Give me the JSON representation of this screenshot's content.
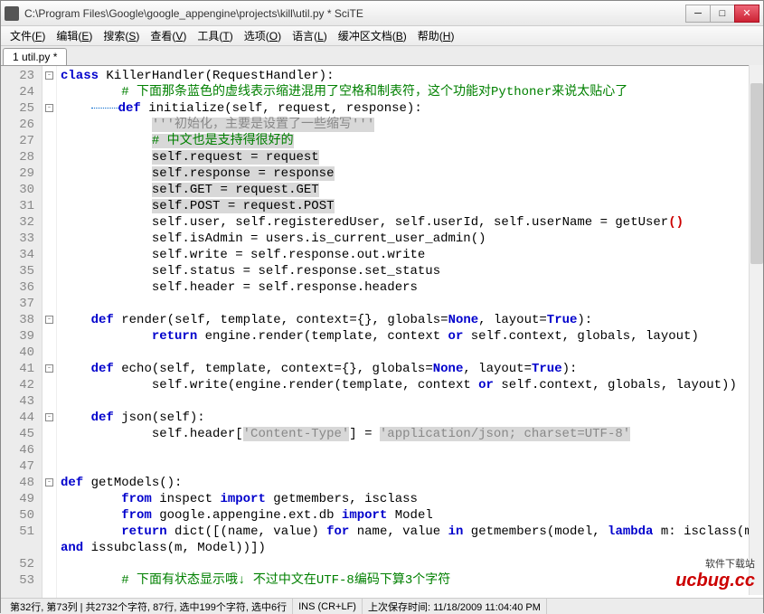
{
  "window": {
    "title": "C:\\Program Files\\Google\\google_appengine\\projects\\kill\\util.py * SciTE"
  },
  "menu": [
    {
      "label": "文件",
      "accel": "F"
    },
    {
      "label": "编辑",
      "accel": "E"
    },
    {
      "label": "搜索",
      "accel": "S"
    },
    {
      "label": "查看",
      "accel": "V"
    },
    {
      "label": "工具",
      "accel": "T"
    },
    {
      "label": "选项",
      "accel": "O"
    },
    {
      "label": "语言",
      "accel": "L"
    },
    {
      "label": "缓冲区文档",
      "accel": "B"
    },
    {
      "label": "帮助",
      "accel": "H"
    }
  ],
  "tabs": [
    {
      "label": "1 util.py *"
    }
  ],
  "gutter_start": 23,
  "gutter_end": 53,
  "statusbar": {
    "pos": "第32行, 第73列 | 共2732个字符, 87行, 选中199个字符, 选中6行",
    "mode": "INS (CR+LF)",
    "saved": "上次保存时间: 11/18/2009 11:04:40 PM"
  },
  "watermark": {
    "brand": "ucbug.cc",
    "sub": "软件下载站"
  },
  "fold_markers": {
    "23": "-",
    "25": "-",
    "38": "-",
    "41": "-",
    "44": "-",
    "48": "-"
  },
  "code": [
    {
      "n": 23,
      "html": "<span class='kw'>class</span> <span class='cls'>KillerHandler</span><span class='op'>(</span>RequestHandler<span class='op'>):</span>"
    },
    {
      "n": 24,
      "html": "    <span class='com'># 下面那条蓝色的虚线表示缩进混用了空格和制表符，这个功能对Pythoner来说太贴心了</span>"
    },
    {
      "n": 25,
      "html": "<span class='blue-line'></span><span class='kw'>def</span> <span class='fn'>initialize</span><span class='op'>(</span>self<span class='op'>,</span> request<span class='op'>,</span> response<span class='op'>):</span>"
    },
    {
      "n": 26,
      "html": "    <span class='sel'><span class='str'>'''初始化，主要是设置了一些缩写'''</span></span>"
    },
    {
      "n": 27,
      "html": "    <span class='sel'><span class='com'># 中文也是支持得很好的</span></span>"
    },
    {
      "n": 28,
      "html": "    <span class='sel'>self<span class='op'>.</span>request <span class='op'>=</span> request</span>"
    },
    {
      "n": 29,
      "html": "    <span class='sel'>self<span class='op'>.</span>response <span class='op'>=</span> response</span>"
    },
    {
      "n": 30,
      "html": "    <span class='sel'>self<span class='op'>.</span>GET <span class='op'>=</span> request<span class='op'>.</span>GET</span>"
    },
    {
      "n": 31,
      "html": "    <span class='sel'>self<span class='op'>.</span>POST <span class='op'>=</span> request<span class='op'>.</span>POST</span>"
    },
    {
      "n": 32,
      "html": "    self<span class='op'>.</span>user<span class='op'>,</span> self<span class='op'>.</span>registeredUser<span class='op'>,</span> self<span class='op'>.</span>userId<span class='op'>,</span> self<span class='op'>.</span>userName <span class='op'>=</span> getUser<span class='paren-red'>()</span>"
    },
    {
      "n": 33,
      "html": "    self<span class='op'>.</span>isAdmin <span class='op'>=</span> users<span class='op'>.</span>is_current_user_admin<span class='op'>()</span>"
    },
    {
      "n": 34,
      "html": "    self<span class='op'>.</span>write <span class='op'>=</span> self<span class='op'>.</span>response<span class='op'>.</span>out<span class='op'>.</span>write"
    },
    {
      "n": 35,
      "html": "    self<span class='op'>.</span>status <span class='op'>=</span> self<span class='op'>.</span>response<span class='op'>.</span>set_status"
    },
    {
      "n": 36,
      "html": "    self<span class='op'>.</span>header <span class='op'>=</span> self<span class='op'>.</span>response<span class='op'>.</span>headers"
    },
    {
      "n": 37,
      "html": ""
    },
    {
      "n": 38,
      "html": "<span class='kw'>def</span> <span class='fn'>render</span><span class='op'>(</span>self<span class='op'>,</span> template<span class='op'>,</span> context<span class='op'>={},</span> globals<span class='op'>=</span><span class='none'>None</span><span class='op'>,</span> layout<span class='op'>=</span><span class='none'>True</span><span class='op'>):</span>"
    },
    {
      "n": 39,
      "html": "    <span class='kw'>return</span> engine<span class='op'>.</span>render<span class='op'>(</span>template<span class='op'>,</span> context <span class='kw'>or</span> self<span class='op'>.</span>context<span class='op'>,</span> globals<span class='op'>,</span> layout<span class='op'>)</span>"
    },
    {
      "n": 40,
      "html": ""
    },
    {
      "n": 41,
      "html": "<span class='kw'>def</span> <span class='fn'>echo</span><span class='op'>(</span>self<span class='op'>,</span> template<span class='op'>,</span> context<span class='op'>={},</span> globals<span class='op'>=</span><span class='none'>None</span><span class='op'>,</span> layout<span class='op'>=</span><span class='none'>True</span><span class='op'>):</span>"
    },
    {
      "n": 42,
      "html": "    self<span class='op'>.</span>write<span class='op'>(</span>engine<span class='op'>.</span>render<span class='op'>(</span>template<span class='op'>,</span> context <span class='kw'>or</span> self<span class='op'>.</span>context<span class='op'>,</span> globals<span class='op'>,</span> layout<span class='op'>))</span>"
    },
    {
      "n": 43,
      "html": ""
    },
    {
      "n": 44,
      "html": "<span class='kw'>def</span> <span class='fn'>json</span><span class='op'>(</span>self<span class='op'>):</span>"
    },
    {
      "n": 45,
      "html": "    self<span class='op'>.</span>header<span class='op'>[</span><span class='sel'><span class='str'>'Content-Type'</span></span><span class='op'>]</span> <span class='op'>=</span> <span class='sel'><span class='str'>'application/json; charset=UTF-8'</span></span>"
    },
    {
      "n": 46,
      "html": ""
    },
    {
      "n": 47,
      "html": ""
    },
    {
      "n": 48,
      "html": "<span class='kw'>def</span> <span class='fn'>getModels</span><span class='op'>():</span>"
    },
    {
      "n": 49,
      "html": "    <span class='kw'>from</span> inspect <span class='kw'>import</span> getmembers<span class='op'>,</span> isclass"
    },
    {
      "n": 50,
      "html": "    <span class='kw'>from</span> google<span class='op'>.</span>appengine<span class='op'>.</span>ext<span class='op'>.</span>db <span class='kw'>import</span> Model"
    },
    {
      "n": 51,
      "html": "    <span class='kw'>return</span> dict<span class='op'>([(</span>name<span class='op'>,</span> value<span class='op'>)</span> <span class='kw'>for</span> name<span class='op'>,</span> value <span class='kw'>in</span> getmembers<span class='op'>(</span>model<span class='op'>,</span> <span class='kw'>lambda</span> m<span class='op'>:</span> isclass<span class='op'>(</span>m<span class='op'>)</span> <span class='kw'>and</span> issubclass<span class='op'>(</span>m<span class='op'>,</span> Model<span class='op'>))])</span>",
      "wrap": true
    },
    {
      "n": 52,
      "html": ""
    },
    {
      "n": 53,
      "html": "    <span class='com'># 下面有状态显示哦↓ 不过中文在UTF-8编码下算3个字符</span>"
    }
  ]
}
